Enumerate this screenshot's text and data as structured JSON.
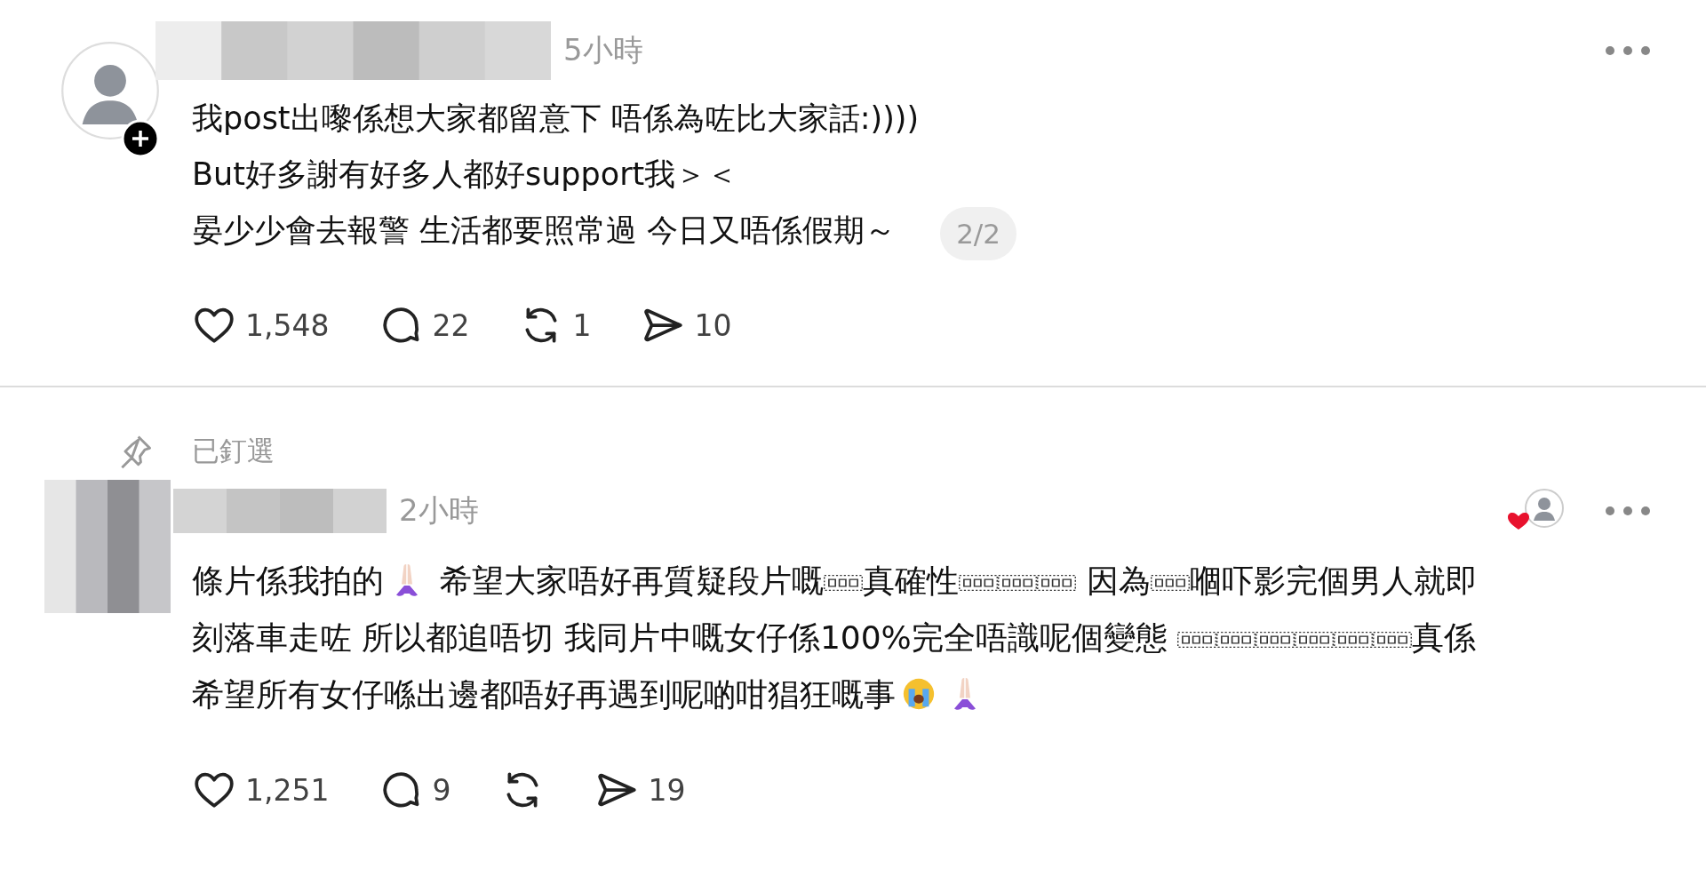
{
  "posts": [
    {
      "avatar": {
        "kind": "default",
        "follow_badge": true
      },
      "time": "5小時",
      "liked_by_author": false,
      "body": [
        {
          "kind": "line",
          "text": "我post出嚟係想大家都留意下 唔係為咗比大家話:))))"
        },
        {
          "kind": "line",
          "text": "But好多謝有好多人都好support我＞＜"
        },
        {
          "kind": "line",
          "text": "晏少少會去報警 生活都要照常過 今日又唔係假期～"
        }
      ],
      "page_indicator": "2/2",
      "actions": [
        {
          "kind": "like",
          "count": "1,548"
        },
        {
          "kind": "reply",
          "count": "22"
        },
        {
          "kind": "repost",
          "count": "1"
        },
        {
          "kind": "share",
          "count": "10"
        }
      ]
    },
    {
      "pinned_label": "已釘選",
      "avatar": {
        "kind": "blurred",
        "follow_badge": false
      },
      "time": "2小時",
      "liked_by_author": true,
      "body": [
        {
          "kind": "text",
          "text": "條片係我拍的"
        },
        {
          "kind": "pray"
        },
        {
          "kind": "text",
          "text": " 希望大家唔好再質疑段片嘅"
        },
        {
          "kind": "obj"
        },
        {
          "kind": "text",
          "text": "真確性"
        },
        {
          "kind": "obj"
        },
        {
          "kind": "obj"
        },
        {
          "kind": "obj"
        },
        {
          "kind": "text",
          "text": " 因為"
        },
        {
          "kind": "obj"
        },
        {
          "kind": "text",
          "text": "嗰吓影完個男人就即刻落車走咗 所以都追唔切 我同片中嘅女仔係100%完全唔識呢個變態 "
        },
        {
          "kind": "obj"
        },
        {
          "kind": "obj"
        },
        {
          "kind": "obj"
        },
        {
          "kind": "obj"
        },
        {
          "kind": "obj"
        },
        {
          "kind": "obj"
        },
        {
          "kind": "text",
          "text": "真係希望所有女仔喺出邊都唔好再遇到呢啲咁猖狂嘅事"
        },
        {
          "kind": "cry"
        },
        {
          "kind": "pray"
        }
      ],
      "actions": [
        {
          "kind": "like",
          "count": "1,251"
        },
        {
          "kind": "reply",
          "count": "9"
        },
        {
          "kind": "repost"
        },
        {
          "kind": "share",
          "count": "19"
        }
      ]
    }
  ]
}
